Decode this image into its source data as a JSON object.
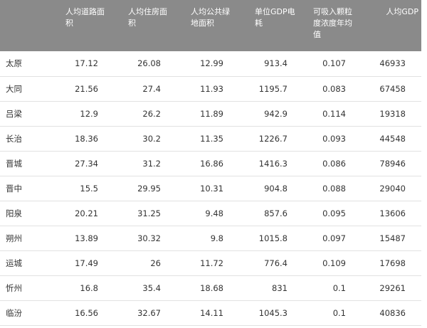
{
  "table": {
    "headers": [
      "",
      "人均道路面积",
      "人均住房面积",
      "人均公共绿地面积",
      "单位GDP电耗",
      "可吸入颗粒度浓度年均值",
      "人均GDP"
    ],
    "rows": [
      [
        "太原",
        "17.12",
        "26.08",
        "12.99",
        "913.4",
        "0.107",
        "46933"
      ],
      [
        "大同",
        "21.56",
        "27.4",
        "11.93",
        "1195.7",
        "0.083",
        "67458"
      ],
      [
        "吕梁",
        "12.9",
        "26.2",
        "11.89",
        "942.9",
        "0.114",
        "19318"
      ],
      [
        "长治",
        "18.36",
        "30.2",
        "11.35",
        "1226.7",
        "0.093",
        "44548"
      ],
      [
        "晋城",
        "27.34",
        "31.2",
        "16.86",
        "1416.3",
        "0.086",
        "78946"
      ],
      [
        "晋中",
        "15.5",
        "29.95",
        "10.31",
        "904.8",
        "0.088",
        "29040"
      ],
      [
        "阳泉",
        "20.21",
        "31.25",
        "9.48",
        "857.6",
        "0.095",
        "13606"
      ],
      [
        "朔州",
        "13.89",
        "30.32",
        "9.8",
        "1015.8",
        "0.097",
        "15487"
      ],
      [
        "运城",
        "17.49",
        "26",
        "11.72",
        "776.4",
        "0.109",
        "17698"
      ],
      [
        "忻州",
        "16.8",
        "35.4",
        "18.68",
        "831",
        "0.1",
        "29261"
      ],
      [
        "临汾",
        "16.56",
        "32.67",
        "14.11",
        "1045.3",
        "0.1",
        "40836"
      ]
    ]
  },
  "colors": {
    "header_bg": "#8a8a8a",
    "header_text": "#ffffff",
    "row_border": "#e2e2e2",
    "cell_text": "#333333"
  }
}
